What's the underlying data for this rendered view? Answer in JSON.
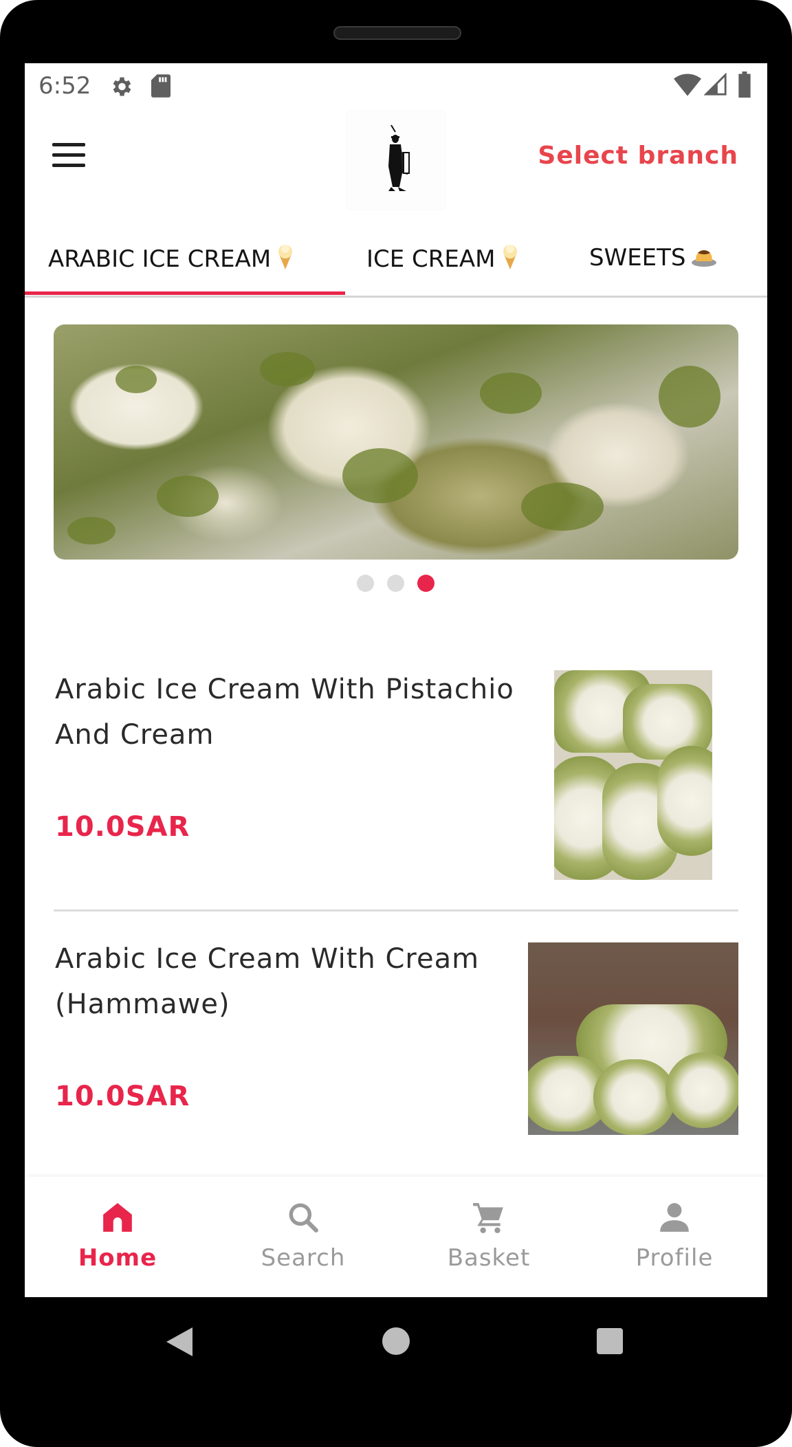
{
  "status_bar": {
    "time": "6:52",
    "icons": [
      "gear-icon",
      "sd-card-icon",
      "wifi-icon",
      "signal-icon",
      "battery-icon"
    ]
  },
  "app_bar": {
    "menu_icon": "hamburger-menu-icon",
    "logo": "brand-logo",
    "select_branch": "Select branch"
  },
  "tabs": [
    {
      "label": "ARABIC ICE CREAM",
      "emoji": "🍦",
      "active": true
    },
    {
      "label": "ICE CREAM",
      "emoji": "🍦",
      "active": false
    },
    {
      "label": "SWEETS",
      "emoji": "🍮",
      "active": false
    }
  ],
  "banner": {
    "image": "pistachio-ice-cream-banner",
    "slide_count": 3,
    "active_slide": 3
  },
  "products": [
    {
      "name": "Arabic Ice Cream With Pistachio And Cream",
      "price": "10.0SAR",
      "image": "pistachio-cream-rolls-photo"
    },
    {
      "name": "Arabic Ice Cream With Cream (Hammawe)",
      "price": "10.0SAR",
      "image": "cream-rolls-pistachio-crust-photo"
    }
  ],
  "bottom_nav": [
    {
      "label": "Home",
      "icon": "home-icon",
      "active": true
    },
    {
      "label": "Search",
      "icon": "search-icon",
      "active": false
    },
    {
      "label": "Basket",
      "icon": "cart-icon",
      "active": false
    },
    {
      "label": "Profile",
      "icon": "person-icon",
      "active": false
    }
  ],
  "colors": {
    "accent": "#e8254b",
    "branch_text": "#e8454c",
    "inactive_nav": "#9a9a9a"
  },
  "system_nav": [
    "back-icon",
    "home-circle-icon",
    "recents-icon"
  ]
}
